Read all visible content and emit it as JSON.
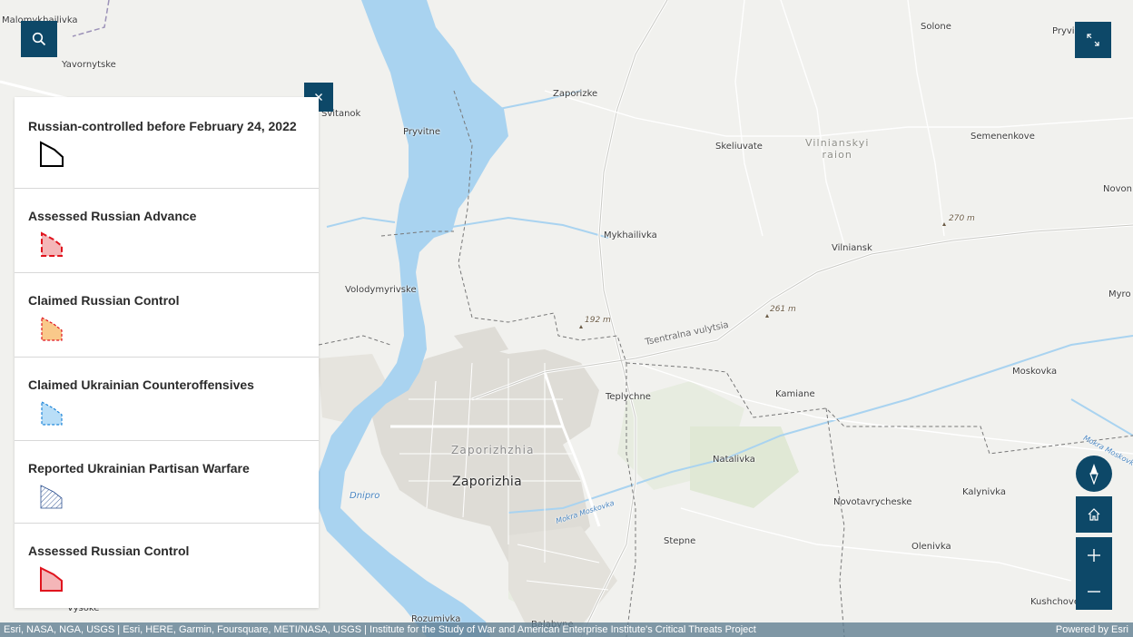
{
  "map": {
    "places": {
      "malomykhailivka": "Malomykhailivka",
      "yavornytske": "Yavornytske",
      "svitanok": "Svitanok",
      "pryvitne": "Pryvitne",
      "zaporizke": "Zaporizke",
      "solone": "Solone",
      "pryvi": "Pryvi",
      "skeliuvate": "Skeliuvate",
      "vilnianskyi_raion_line1": "Vilnianskyi",
      "vilnianskyi_raion_line2": "raion",
      "semenenkove": "Semenenkove",
      "novon": "Novon",
      "mykhailivka": "Mykhailivka",
      "vilniansk": "Vilniansk",
      "volodymyrivske": "Volodymyrivske",
      "myro": "Myro",
      "tsentralna": "Tsentralna vulytsia",
      "teplychne": "Teplychne",
      "kamiane": "Kamiane",
      "moskovka": "Moskovka",
      "mokra_moskovka_east": "Mokra Moskovka",
      "zaporizhzhia_district": "Zaporizhzhia",
      "zaporizhia_city": "Zaporizhia",
      "natalivka": "Natalivka",
      "dnipro": "Dnipro",
      "mokra_moskovka_west": "Mokra Moskovka",
      "novotavrycheske": "Novotavrycheske",
      "kalynivka": "Kalynivka",
      "stepne": "Stepne",
      "olenivka": "Olenivka",
      "kushchove": "Kushchove",
      "vysoke": "Vysoke",
      "rozumivka": "Rozumivka",
      "balabyne": "Balabyne"
    },
    "elevations": {
      "e270": "270 m",
      "e192": "192 m",
      "e261": "261 m"
    },
    "colors": {
      "water": "#a9d3f0",
      "land": "#f1f1ee",
      "urban": "#dcdcd6",
      "green": "#d7e4c8",
      "road": "#ffffff",
      "boundary": "#6f6f6f"
    }
  },
  "controls": {
    "search_icon": "search-icon",
    "fullscreen_icon": "expand-icon",
    "close_icon": "close-icon",
    "compass_icon": "compass-icon",
    "home_icon": "home-icon",
    "zoom_in_icon": "plus-icon",
    "zoom_out_icon": "minus-icon",
    "accent_color": "#0d4868"
  },
  "legend": {
    "items": [
      {
        "label": "Russian-controlled before February 24, 2022",
        "swatch": "black-outline",
        "stroke": "#000000",
        "fill": "none"
      },
      {
        "label": "Assessed Russian Advance",
        "swatch": "red-dashed-pink-fill",
        "stroke": "#e0141e",
        "fill": "#f4b6b8"
      },
      {
        "label": "Claimed Russian Control",
        "swatch": "red-dashed-orange-fill",
        "stroke": "#e0141e",
        "fill": "#f9c98a"
      },
      {
        "label": "Claimed Ukrainian Counteroffensives",
        "swatch": "blue-dashed-light-blue-fill",
        "stroke": "#1f86d9",
        "fill": "#b9def7"
      },
      {
        "label": "Reported Ukrainian Partisan Warfare",
        "swatch": "blue-hatch",
        "stroke": "#2a4f8f",
        "fill": "hatch"
      },
      {
        "label": "Assessed Russian Control",
        "swatch": "red-solid-pink-fill",
        "stroke": "#e0141e",
        "fill": "#f4b6b8"
      }
    ]
  },
  "attribution": {
    "text": "Esri, NASA, NGA, USGS | Esri, HERE, Garmin, Foursquare, METI/NASA, USGS | Institute for the Study of War and American Enterprise Institute's Critical Threats Project",
    "powered_by": "Powered by Esri"
  }
}
